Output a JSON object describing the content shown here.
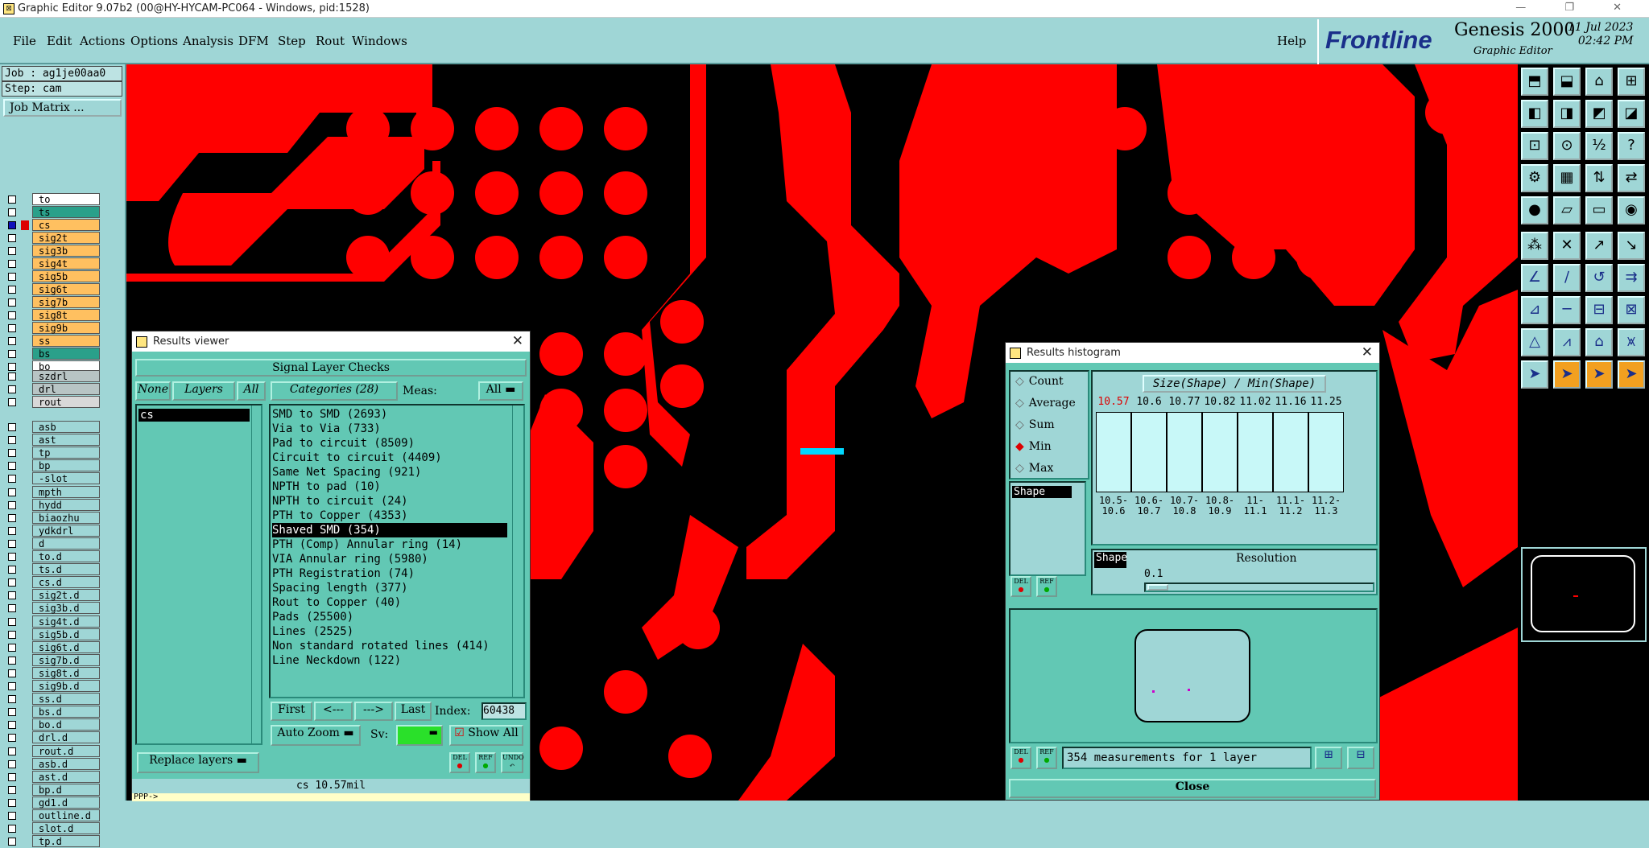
{
  "titlebar": {
    "title": "Graphic Editor 9.07b2 (00@HY-HYCAM-PC064 - Windows, pid:1528)"
  },
  "menu": {
    "items": [
      "File",
      "Edit",
      "Actions",
      "Options",
      "Analysis",
      "DFM",
      "Step",
      "Rout",
      "Windows"
    ],
    "help": "Help"
  },
  "brand": {
    "logo": "Frontline",
    "product": "Genesis 2000",
    "subtitle": "Graphic Editor",
    "date": "11 Jul 2023",
    "time": "02:42 PM"
  },
  "job": {
    "job": "Job : ag1je00aa0",
    "step": "Step: cam",
    "matrix_button": "Job Matrix ..."
  },
  "layers": {
    "board": [
      {
        "name": "to",
        "color": "#ffffff",
        "selected": false
      },
      {
        "name": "ts",
        "color": "#2aa08a",
        "selected": false
      },
      {
        "name": "cs",
        "color": "#ffc060",
        "selected": true
      },
      {
        "name": "sig2t",
        "color": "#ffc060",
        "selected": false
      },
      {
        "name": "sig3b",
        "color": "#ffc060",
        "selected": false
      },
      {
        "name": "sig4t",
        "color": "#ffc060",
        "selected": false
      },
      {
        "name": "sig5b",
        "color": "#ffc060",
        "selected": false
      },
      {
        "name": "sig6t",
        "color": "#ffc060",
        "selected": false
      },
      {
        "name": "sig7b",
        "color": "#ffc060",
        "selected": false
      },
      {
        "name": "sig8t",
        "color": "#ffc060",
        "selected": false
      },
      {
        "name": "sig9b",
        "color": "#ffc060",
        "selected": false
      },
      {
        "name": "ss",
        "color": "#ffc060",
        "selected": false
      },
      {
        "name": "bs",
        "color": "#2aa08a",
        "selected": false
      },
      {
        "name": "bo",
        "color": "#ffffff",
        "selected": false
      }
    ],
    "drill": [
      {
        "name": "szdrl",
        "color": "#b8c4c4"
      },
      {
        "name": "drl",
        "color": "#b8c4c4"
      },
      {
        "name": "rout",
        "color": "#d8d8d8"
      }
    ],
    "misc": [
      "asb",
      "ast",
      "tp",
      "bp",
      "-slot",
      "mpth",
      "hydd",
      "biaozhu",
      "ydkdrl",
      "d",
      "to.d",
      "ts.d",
      "cs.d",
      "sig2t.d",
      "sig3b.d",
      "sig4t.d",
      "sig5b.d",
      "sig6t.d",
      "sig7b.d",
      "sig8t.d",
      "sig9b.d",
      "ss.d",
      "bs.d",
      "bo.d",
      "drl.d",
      "rout.d",
      "asb.d",
      "ast.d",
      "bp.d",
      "gd1.d",
      "outline.d",
      "slot.d",
      "tp.d"
    ]
  },
  "results_viewer": {
    "title": "Results viewer",
    "header": "Signal Layer Checks",
    "none": "None",
    "layers_btn": "Layers",
    "all": "All",
    "layer_list": [
      "cs"
    ],
    "categories_btn": "Categories (28)",
    "meas_label": "Meas:",
    "meas_value": "All",
    "categories": [
      "SMD to SMD (2693)",
      "Via to Via (733)",
      "Pad to circuit (8509)",
      "Circuit to circuit (4409)",
      "Same Net Spacing (921)",
      "NPTH to pad (10)",
      "NPTH to circuit (24)",
      "PTH to Copper (4353)",
      "Shaved SMD (354)",
      "PTH (Comp) Annular ring (14)",
      "VIA Annular ring (5980)",
      "PTH Registration (74)",
      "Spacing length (377)",
      "Rout to Copper (40)",
      "Pads (25500)",
      "Lines (2525)",
      "Non standard rotated lines (414)",
      "Line Neckdown (122)"
    ],
    "selected_category": "Shaved SMD (354)",
    "first": "First",
    "prev": "<---",
    "next": "--->",
    "last": "Last",
    "index_label": "Index:",
    "index_value": "60438",
    "auto_zoom": "Auto Zoom",
    "sv_label": "Sv:",
    "show_all": "Show All",
    "replace_layers": "Replace layers",
    "del": "DEL",
    "ref": "REF",
    "undo": "UNDO",
    "status": "cs 10.57mil",
    "prompt": "PPP->"
  },
  "histogram": {
    "title": "Results histogram",
    "options": [
      "Count",
      "Average",
      "Sum",
      "Min",
      "Max"
    ],
    "selected_option": "Min",
    "chart_title": "Size(Shape) / Min(Shape)",
    "shape_item": "Shape",
    "bars": [
      {
        "value": "10.57",
        "range": [
          "10.5-",
          "10.6"
        ],
        "highlight": true
      },
      {
        "value": "10.6",
        "range": [
          "10.6-",
          "10.7"
        ],
        "highlight": false
      },
      {
        "value": "10.77",
        "range": [
          "10.7-",
          "10.8"
        ],
        "highlight": false
      },
      {
        "value": "10.82",
        "range": [
          "10.8-",
          "10.9"
        ],
        "highlight": false
      },
      {
        "value": "11.02",
        "range": [
          "11-",
          "11.1"
        ],
        "highlight": false
      },
      {
        "value": "11.16",
        "range": [
          "11.1-",
          "11.2"
        ],
        "highlight": false
      },
      {
        "value": "11.25",
        "range": [
          "11.2-",
          "11.3"
        ],
        "highlight": false
      }
    ],
    "shape_label": "Shape",
    "resolution_label": "Resolution",
    "resolution_value": "0.1",
    "del": "DEL",
    "ref": "REF",
    "status": "354 measurements for 1 layer",
    "close": "Close"
  }
}
